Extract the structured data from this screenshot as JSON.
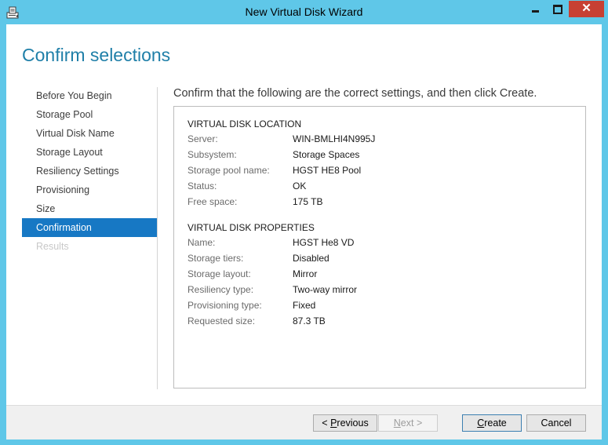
{
  "window": {
    "title": "New Virtual Disk Wizard",
    "controls": {
      "minimize": "minimize",
      "maximize": "maximize",
      "close": "✕"
    }
  },
  "page": {
    "heading": "Confirm selections",
    "instruction": "Confirm that the following are the correct settings, and then click Create."
  },
  "nav": {
    "items": [
      {
        "label": "Before You Begin",
        "state": "normal"
      },
      {
        "label": "Storage Pool",
        "state": "normal"
      },
      {
        "label": "Virtual Disk Name",
        "state": "normal"
      },
      {
        "label": "Storage Layout",
        "state": "normal"
      },
      {
        "label": "Resiliency Settings",
        "state": "normal"
      },
      {
        "label": "Provisioning",
        "state": "normal"
      },
      {
        "label": "Size",
        "state": "normal"
      },
      {
        "label": "Confirmation",
        "state": "active"
      },
      {
        "label": "Results",
        "state": "disabled"
      }
    ]
  },
  "location": {
    "heading": "VIRTUAL DISK LOCATION",
    "rows": [
      {
        "label": "Server:",
        "value": "WIN-BMLHI4N995J"
      },
      {
        "label": "Subsystem:",
        "value": "Storage Spaces"
      },
      {
        "label": "Storage pool name:",
        "value": "HGST HE8 Pool"
      },
      {
        "label": "Status:",
        "value": "OK"
      },
      {
        "label": "Free space:",
        "value": "175 TB"
      }
    ]
  },
  "properties": {
    "heading": "VIRTUAL DISK PROPERTIES",
    "rows": [
      {
        "label": "Name:",
        "value": "HGST He8 VD"
      },
      {
        "label": "Storage tiers:",
        "value": "Disabled"
      },
      {
        "label": "Storage layout:",
        "value": "Mirror"
      },
      {
        "label": "Resiliency type:",
        "value": "Two-way mirror"
      },
      {
        "label": "Provisioning type:",
        "value": "Fixed"
      },
      {
        "label": "Requested size:",
        "value": "87.3 TB"
      }
    ]
  },
  "buttons": {
    "previous": {
      "accel": "P",
      "text": "revious",
      "prefix": "< "
    },
    "next": {
      "accel": "N",
      "text": "ext",
      "suffix": " >"
    },
    "create": {
      "accel": "C",
      "text": "reate"
    },
    "cancel": "Cancel"
  },
  "colors": {
    "chrome": "#5fc7e8",
    "accent": "#1778c4",
    "heading": "#1f7fa8",
    "close": "#c74033"
  }
}
